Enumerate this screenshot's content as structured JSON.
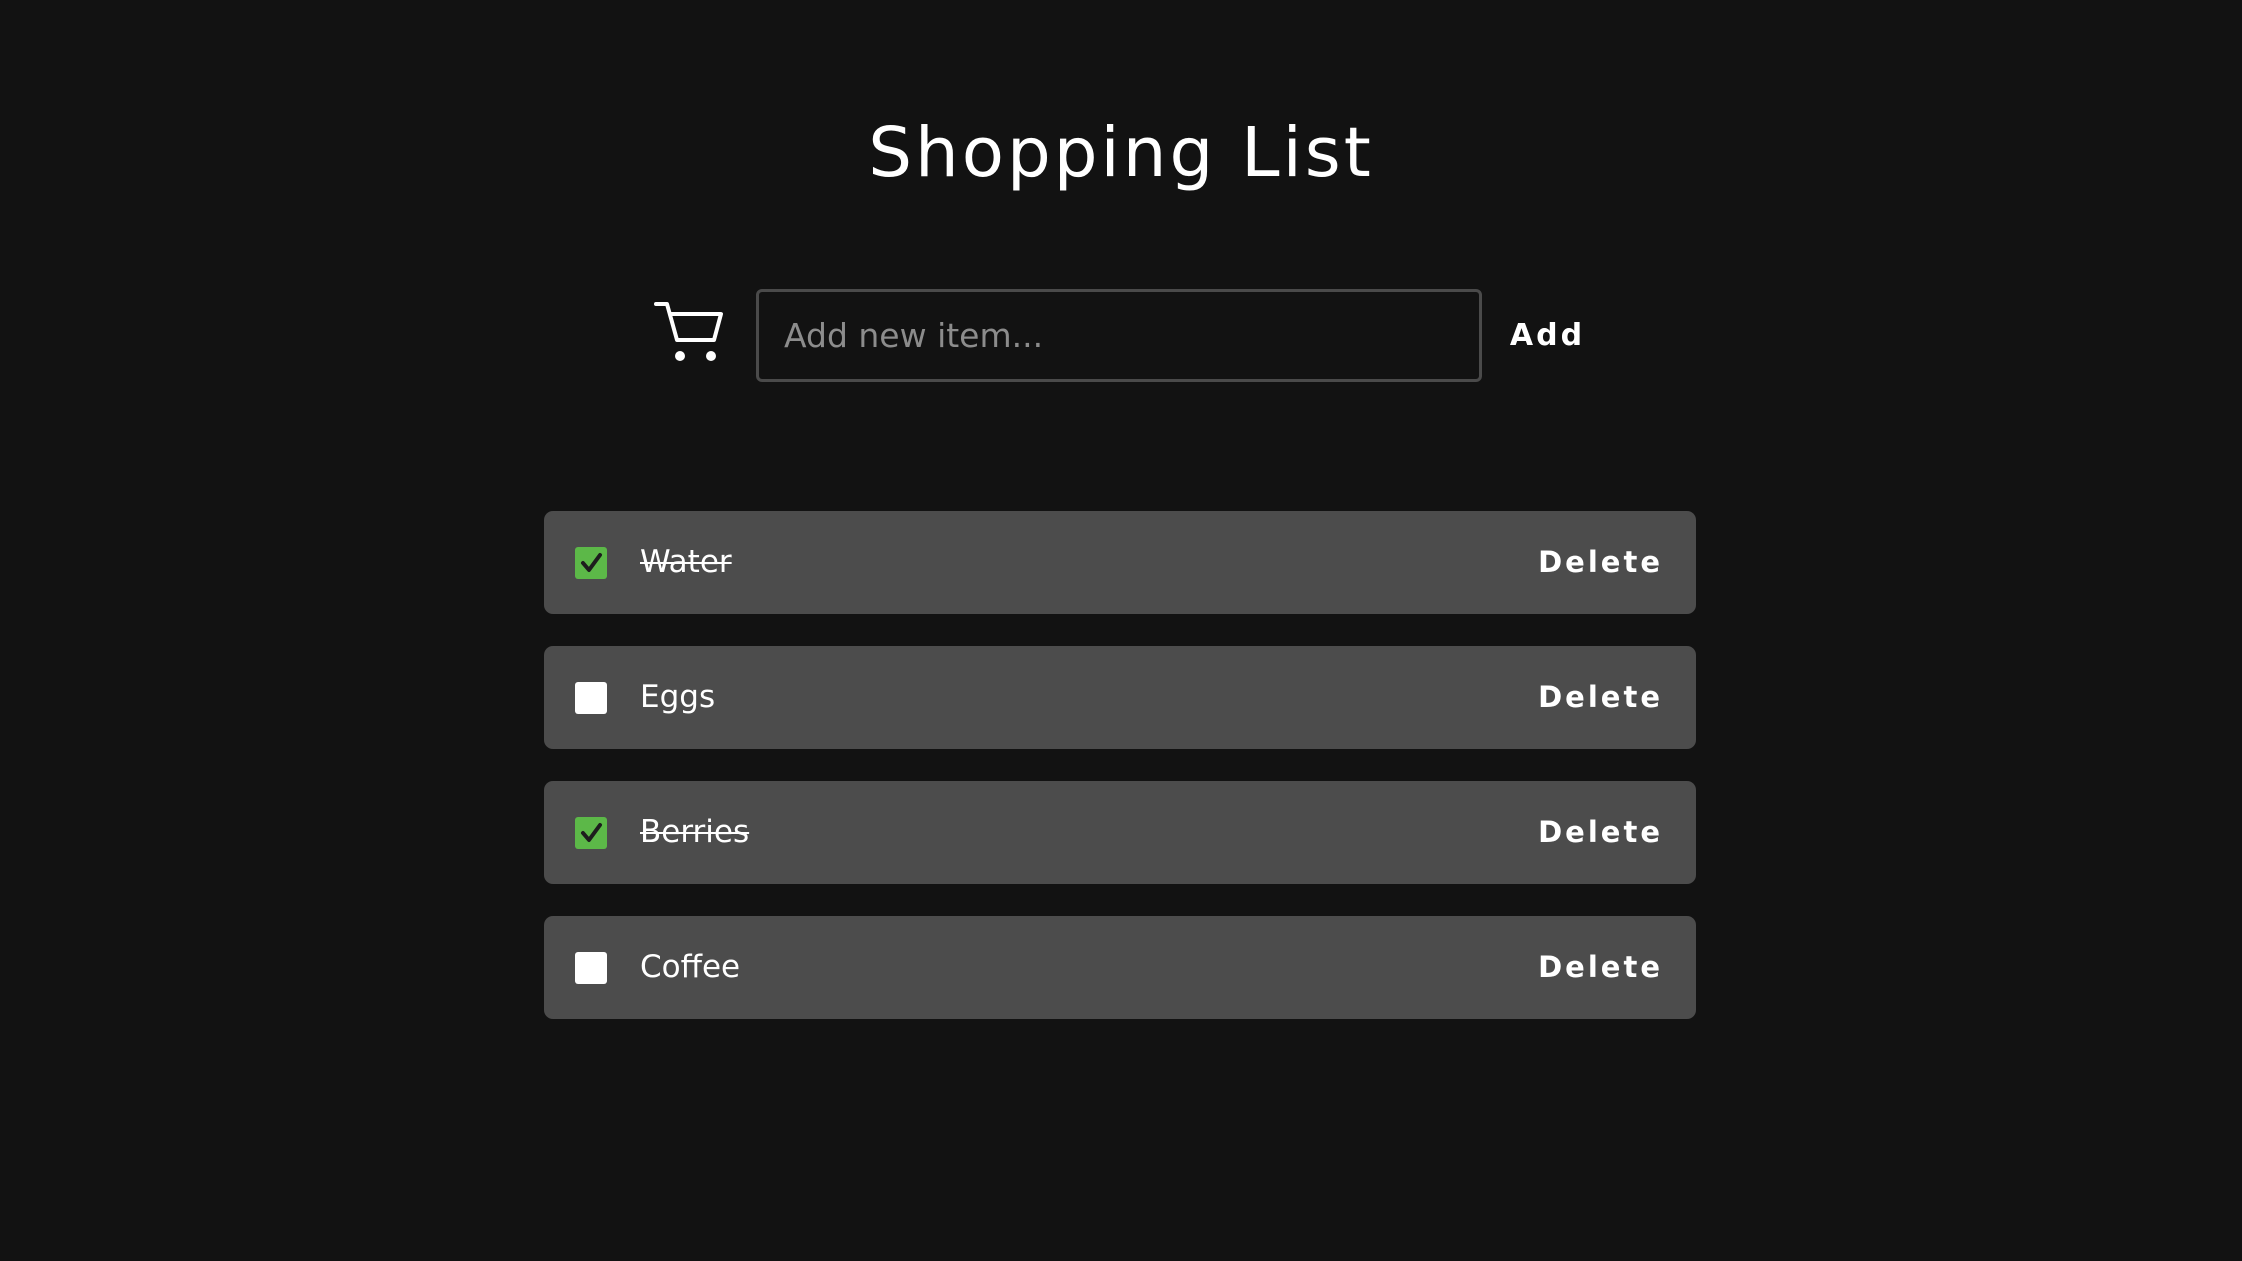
{
  "header": {
    "title": "Shopping List"
  },
  "add_form": {
    "cart_icon": "shopping-cart-icon",
    "input_placeholder": "Add new item...",
    "input_value": "",
    "add_label": "Add"
  },
  "items": [
    {
      "label": "Water",
      "checked": true,
      "delete_label": "Delete"
    },
    {
      "label": "Eggs",
      "checked": false,
      "delete_label": "Delete"
    },
    {
      "label": "Berries",
      "checked": true,
      "delete_label": "Delete"
    },
    {
      "label": "Coffee",
      "checked": false,
      "delete_label": "Delete"
    }
  ],
  "colors": {
    "background": "#121212",
    "item_background": "#4c4c4c",
    "check_accent": "#5cb848",
    "text": "#ffffff"
  }
}
